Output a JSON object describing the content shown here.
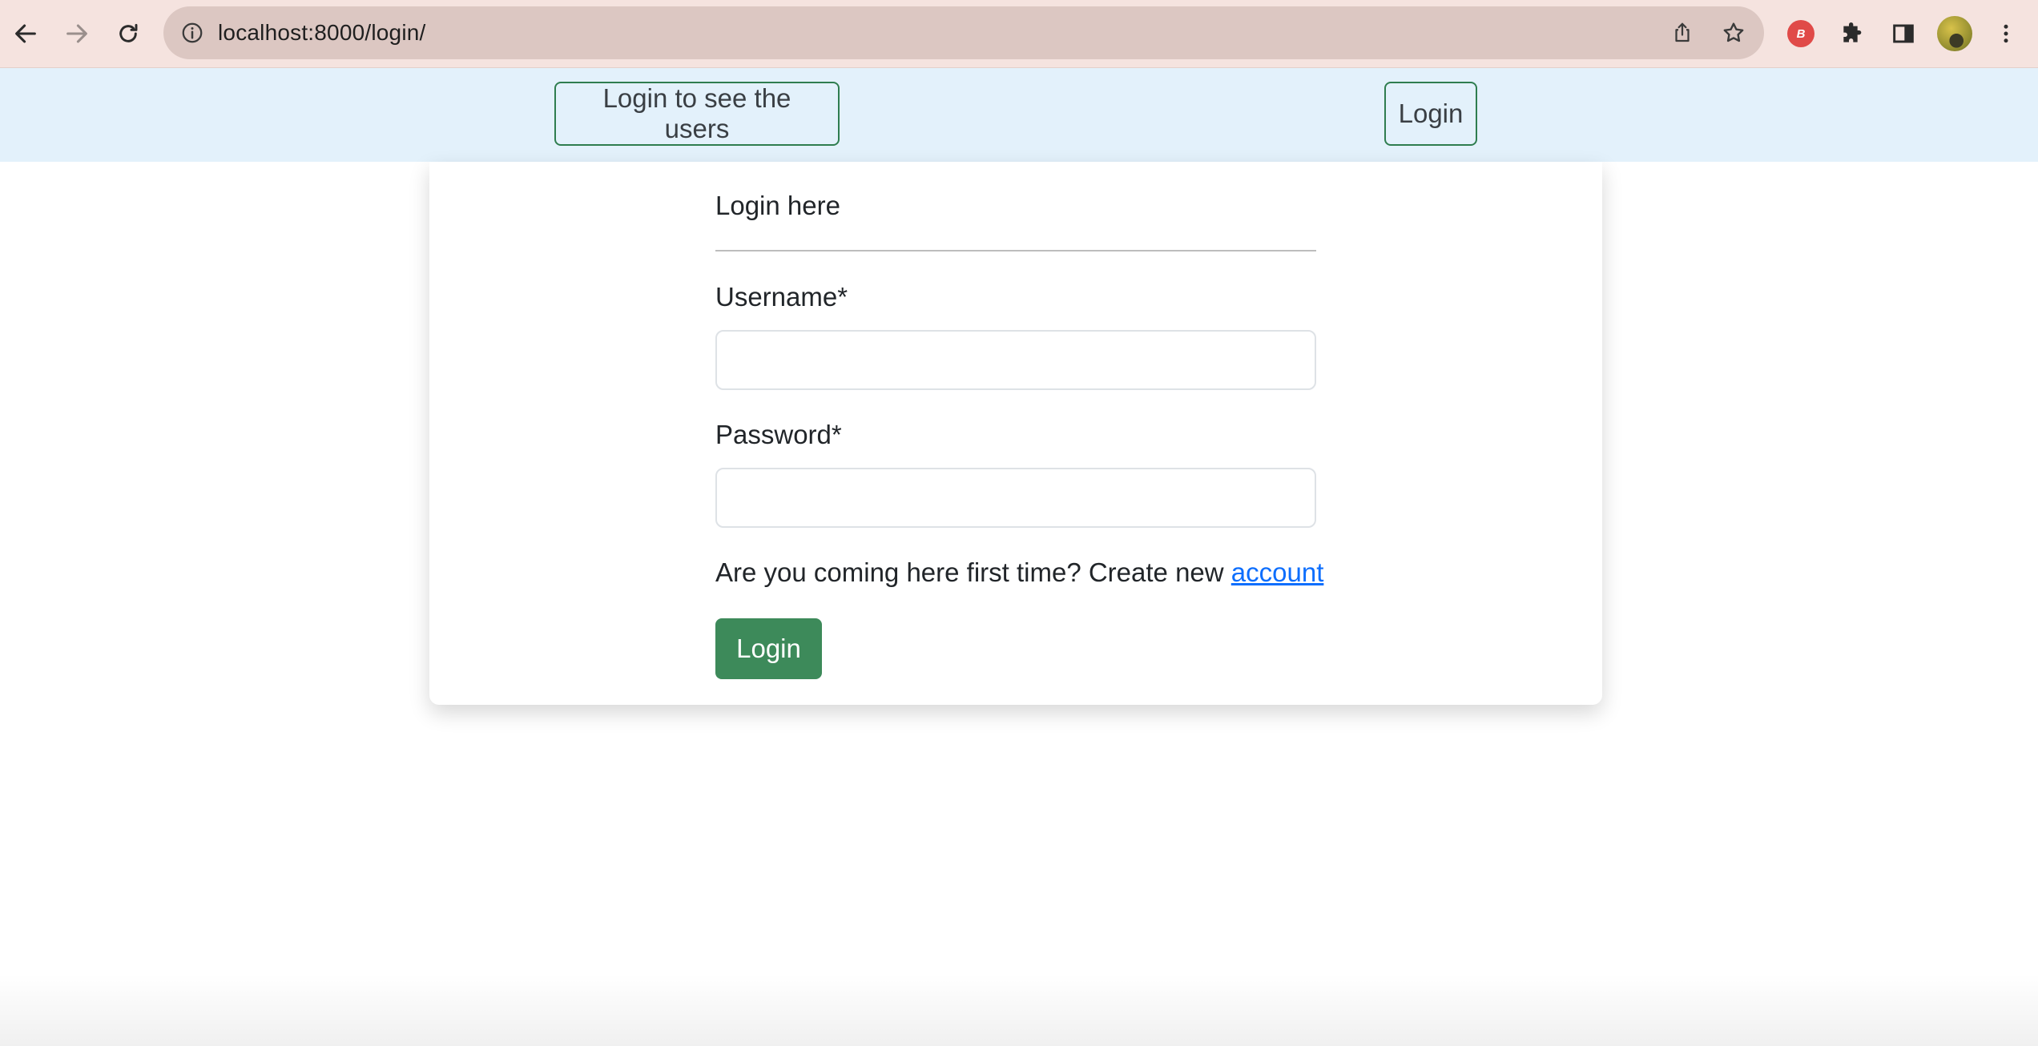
{
  "browser": {
    "url": "localhost:8000/login/",
    "extension_badge": "B"
  },
  "navbar": {
    "users_button": "Login to see the users",
    "login_button": "Login"
  },
  "form": {
    "title": "Login here",
    "username_label": "Username*",
    "username_value": "",
    "password_label": "Password*",
    "password_value": "",
    "signup_prompt": "Are you coming here first time? Create new",
    "signup_link": "account",
    "submit_label": "Login"
  },
  "colors": {
    "navbar_bg": "#e3f1fb",
    "nav_button_border": "#2f7d4f",
    "submit_bg": "#3d8a5a",
    "link": "#0d6efd"
  }
}
